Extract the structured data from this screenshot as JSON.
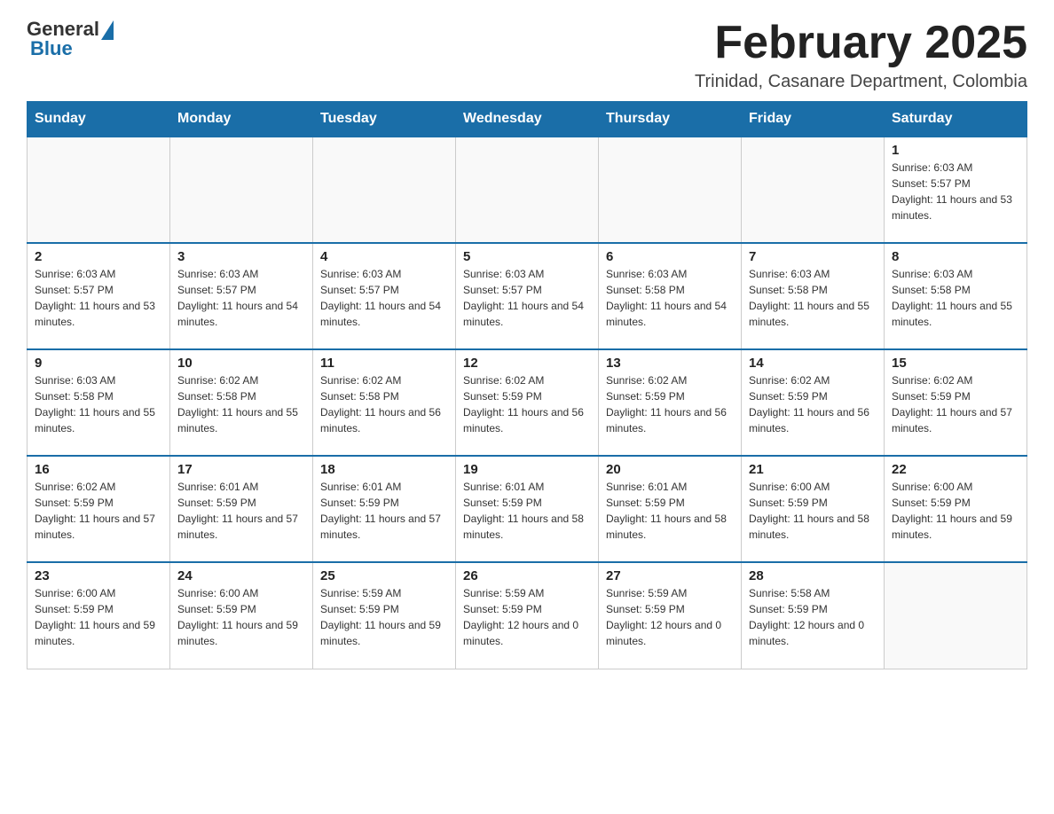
{
  "logo": {
    "general": "General",
    "blue": "Blue"
  },
  "header": {
    "month_title": "February 2025",
    "location": "Trinidad, Casanare Department, Colombia"
  },
  "days_of_week": [
    "Sunday",
    "Monday",
    "Tuesday",
    "Wednesday",
    "Thursday",
    "Friday",
    "Saturday"
  ],
  "weeks": [
    [
      {
        "day": "",
        "sunrise": "",
        "sunset": "",
        "daylight": "",
        "empty": true
      },
      {
        "day": "",
        "sunrise": "",
        "sunset": "",
        "daylight": "",
        "empty": true
      },
      {
        "day": "",
        "sunrise": "",
        "sunset": "",
        "daylight": "",
        "empty": true
      },
      {
        "day": "",
        "sunrise": "",
        "sunset": "",
        "daylight": "",
        "empty": true
      },
      {
        "day": "",
        "sunrise": "",
        "sunset": "",
        "daylight": "",
        "empty": true
      },
      {
        "day": "",
        "sunrise": "",
        "sunset": "",
        "daylight": "",
        "empty": true
      },
      {
        "day": "1",
        "sunrise": "Sunrise: 6:03 AM",
        "sunset": "Sunset: 5:57 PM",
        "daylight": "Daylight: 11 hours and 53 minutes.",
        "empty": false
      }
    ],
    [
      {
        "day": "2",
        "sunrise": "Sunrise: 6:03 AM",
        "sunset": "Sunset: 5:57 PM",
        "daylight": "Daylight: 11 hours and 53 minutes.",
        "empty": false
      },
      {
        "day": "3",
        "sunrise": "Sunrise: 6:03 AM",
        "sunset": "Sunset: 5:57 PM",
        "daylight": "Daylight: 11 hours and 54 minutes.",
        "empty": false
      },
      {
        "day": "4",
        "sunrise": "Sunrise: 6:03 AM",
        "sunset": "Sunset: 5:57 PM",
        "daylight": "Daylight: 11 hours and 54 minutes.",
        "empty": false
      },
      {
        "day": "5",
        "sunrise": "Sunrise: 6:03 AM",
        "sunset": "Sunset: 5:57 PM",
        "daylight": "Daylight: 11 hours and 54 minutes.",
        "empty": false
      },
      {
        "day": "6",
        "sunrise": "Sunrise: 6:03 AM",
        "sunset": "Sunset: 5:58 PM",
        "daylight": "Daylight: 11 hours and 54 minutes.",
        "empty": false
      },
      {
        "day": "7",
        "sunrise": "Sunrise: 6:03 AM",
        "sunset": "Sunset: 5:58 PM",
        "daylight": "Daylight: 11 hours and 55 minutes.",
        "empty": false
      },
      {
        "day": "8",
        "sunrise": "Sunrise: 6:03 AM",
        "sunset": "Sunset: 5:58 PM",
        "daylight": "Daylight: 11 hours and 55 minutes.",
        "empty": false
      }
    ],
    [
      {
        "day": "9",
        "sunrise": "Sunrise: 6:03 AM",
        "sunset": "Sunset: 5:58 PM",
        "daylight": "Daylight: 11 hours and 55 minutes.",
        "empty": false
      },
      {
        "day": "10",
        "sunrise": "Sunrise: 6:02 AM",
        "sunset": "Sunset: 5:58 PM",
        "daylight": "Daylight: 11 hours and 55 minutes.",
        "empty": false
      },
      {
        "day": "11",
        "sunrise": "Sunrise: 6:02 AM",
        "sunset": "Sunset: 5:58 PM",
        "daylight": "Daylight: 11 hours and 56 minutes.",
        "empty": false
      },
      {
        "day": "12",
        "sunrise": "Sunrise: 6:02 AM",
        "sunset": "Sunset: 5:59 PM",
        "daylight": "Daylight: 11 hours and 56 minutes.",
        "empty": false
      },
      {
        "day": "13",
        "sunrise": "Sunrise: 6:02 AM",
        "sunset": "Sunset: 5:59 PM",
        "daylight": "Daylight: 11 hours and 56 minutes.",
        "empty": false
      },
      {
        "day": "14",
        "sunrise": "Sunrise: 6:02 AM",
        "sunset": "Sunset: 5:59 PM",
        "daylight": "Daylight: 11 hours and 56 minutes.",
        "empty": false
      },
      {
        "day": "15",
        "sunrise": "Sunrise: 6:02 AM",
        "sunset": "Sunset: 5:59 PM",
        "daylight": "Daylight: 11 hours and 57 minutes.",
        "empty": false
      }
    ],
    [
      {
        "day": "16",
        "sunrise": "Sunrise: 6:02 AM",
        "sunset": "Sunset: 5:59 PM",
        "daylight": "Daylight: 11 hours and 57 minutes.",
        "empty": false
      },
      {
        "day": "17",
        "sunrise": "Sunrise: 6:01 AM",
        "sunset": "Sunset: 5:59 PM",
        "daylight": "Daylight: 11 hours and 57 minutes.",
        "empty": false
      },
      {
        "day": "18",
        "sunrise": "Sunrise: 6:01 AM",
        "sunset": "Sunset: 5:59 PM",
        "daylight": "Daylight: 11 hours and 57 minutes.",
        "empty": false
      },
      {
        "day": "19",
        "sunrise": "Sunrise: 6:01 AM",
        "sunset": "Sunset: 5:59 PM",
        "daylight": "Daylight: 11 hours and 58 minutes.",
        "empty": false
      },
      {
        "day": "20",
        "sunrise": "Sunrise: 6:01 AM",
        "sunset": "Sunset: 5:59 PM",
        "daylight": "Daylight: 11 hours and 58 minutes.",
        "empty": false
      },
      {
        "day": "21",
        "sunrise": "Sunrise: 6:00 AM",
        "sunset": "Sunset: 5:59 PM",
        "daylight": "Daylight: 11 hours and 58 minutes.",
        "empty": false
      },
      {
        "day": "22",
        "sunrise": "Sunrise: 6:00 AM",
        "sunset": "Sunset: 5:59 PM",
        "daylight": "Daylight: 11 hours and 59 minutes.",
        "empty": false
      }
    ],
    [
      {
        "day": "23",
        "sunrise": "Sunrise: 6:00 AM",
        "sunset": "Sunset: 5:59 PM",
        "daylight": "Daylight: 11 hours and 59 minutes.",
        "empty": false
      },
      {
        "day": "24",
        "sunrise": "Sunrise: 6:00 AM",
        "sunset": "Sunset: 5:59 PM",
        "daylight": "Daylight: 11 hours and 59 minutes.",
        "empty": false
      },
      {
        "day": "25",
        "sunrise": "Sunrise: 5:59 AM",
        "sunset": "Sunset: 5:59 PM",
        "daylight": "Daylight: 11 hours and 59 minutes.",
        "empty": false
      },
      {
        "day": "26",
        "sunrise": "Sunrise: 5:59 AM",
        "sunset": "Sunset: 5:59 PM",
        "daylight": "Daylight: 12 hours and 0 minutes.",
        "empty": false
      },
      {
        "day": "27",
        "sunrise": "Sunrise: 5:59 AM",
        "sunset": "Sunset: 5:59 PM",
        "daylight": "Daylight: 12 hours and 0 minutes.",
        "empty": false
      },
      {
        "day": "28",
        "sunrise": "Sunrise: 5:58 AM",
        "sunset": "Sunset: 5:59 PM",
        "daylight": "Daylight: 12 hours and 0 minutes.",
        "empty": false
      },
      {
        "day": "",
        "sunrise": "",
        "sunset": "",
        "daylight": "",
        "empty": true
      }
    ]
  ]
}
